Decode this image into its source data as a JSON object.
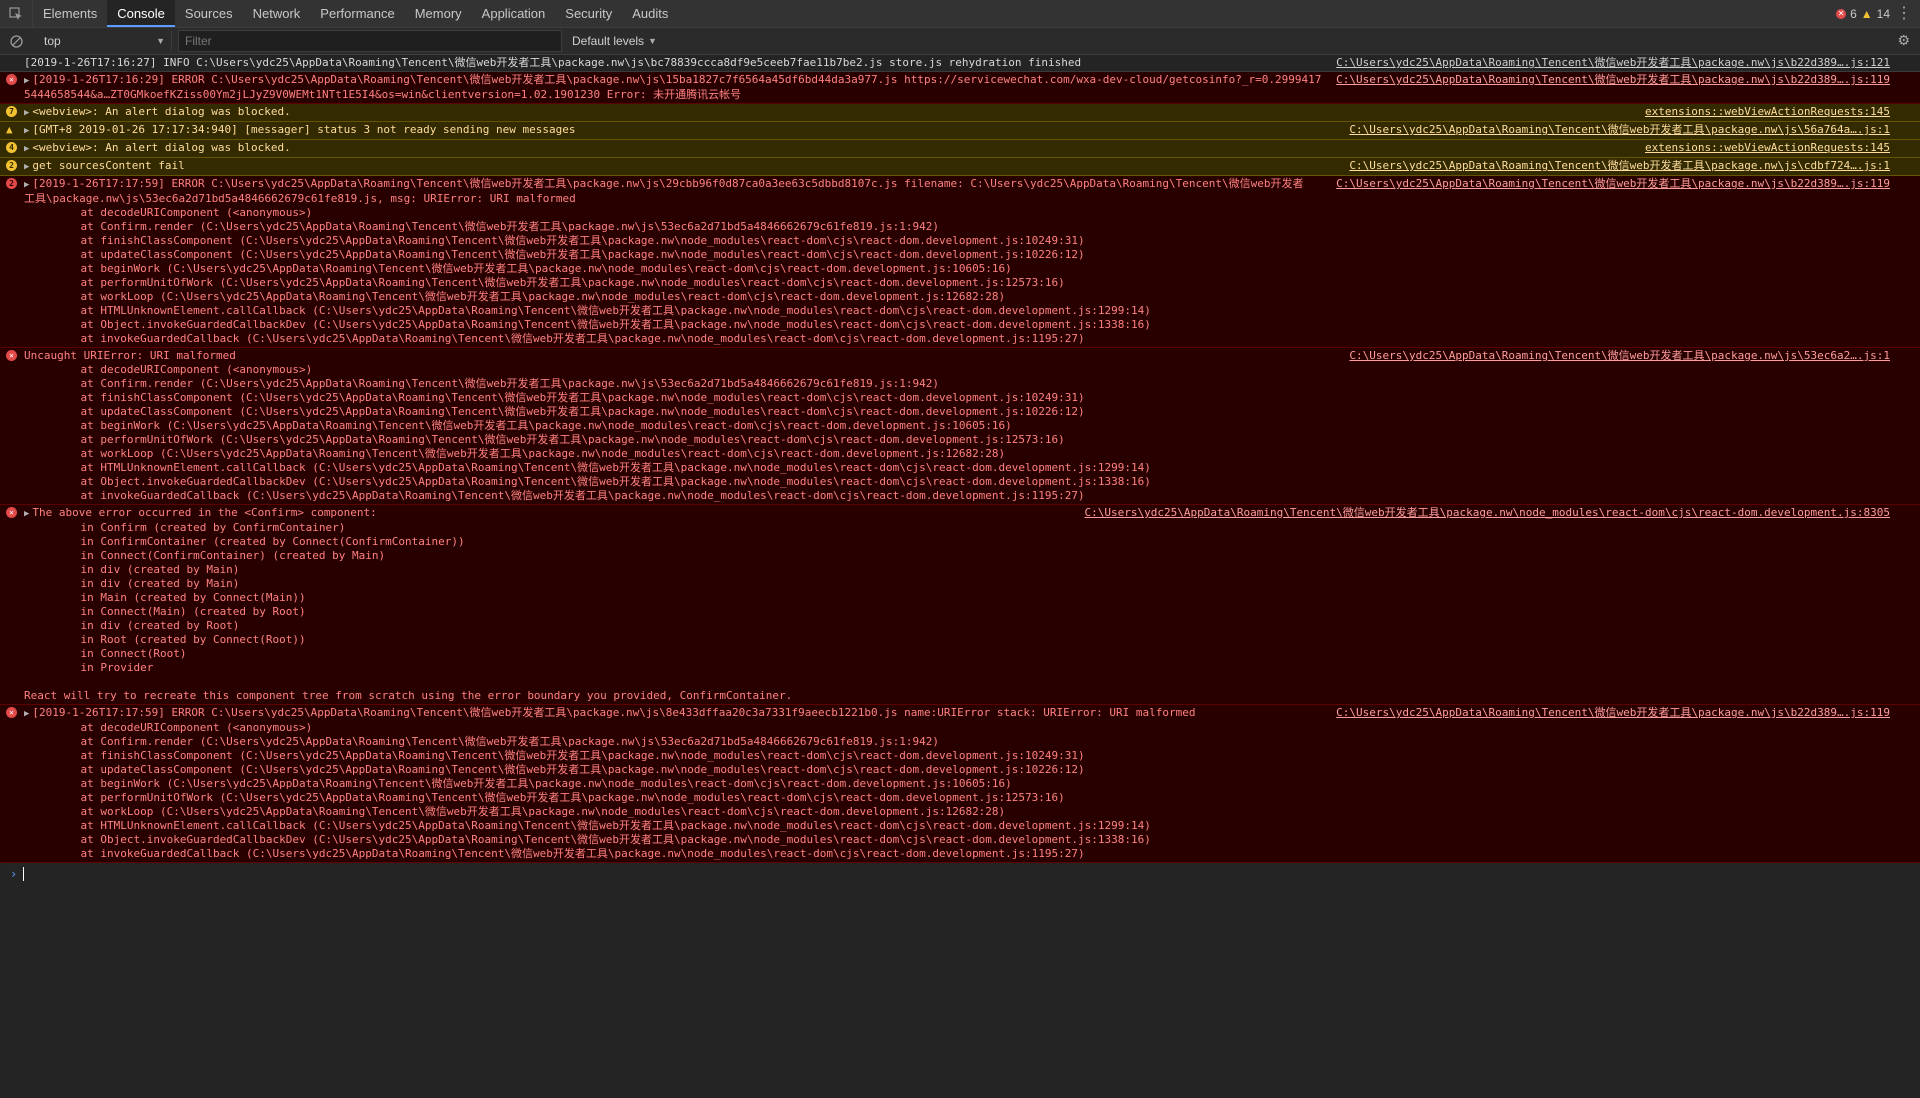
{
  "tabs": [
    "Elements",
    "Console",
    "Sources",
    "Network",
    "Performance",
    "Memory",
    "Application",
    "Security",
    "Audits"
  ],
  "counts": {
    "errors": "6",
    "warnings": "14"
  },
  "toolbar": {
    "context": "top",
    "filter_placeholder": "Filter",
    "levels": "Default levels"
  },
  "messages": [
    {
      "level": "info",
      "badge": "",
      "expand": false,
      "text": "[2019-1-26T17:16:27] INFO C:\\Users\\ydc25\\AppData\\Roaming\\Tencent\\微信web开发者工具\\package.nw\\js\\bc78839ccca8df9e5ceeb7fae11b7be2.js store.js rehydration finished",
      "source": "C:\\Users\\ydc25\\AppData\\Roaming\\Tencent\\微信web开发者工具\\package.nw\\js\\b22d389….js:121",
      "stack": []
    },
    {
      "level": "error",
      "badge": "",
      "expand": true,
      "text": "[2019-1-26T17:16:29] ERROR C:\\Users\\ydc25\\AppData\\Roaming\\Tencent\\微信web开发者工具\\package.nw\\js\\15ba1827c7f6564a45df6bd44da3a977.js https://servicewechat.com/wxa-dev-cloud/getcosinfo?_r=0.2999417",
      "source": "C:\\Users\\ydc25\\AppData\\Roaming\\Tencent\\微信web开发者工具\\package.nw\\js\\b22d389….js:119",
      "stack": [
        "5444658544&a…ZT0GMkoefKZiss00Ym2jLJyZ9V0WEMt1NTt1E5I4&os=win&clientversion=1.02.1901230 Error: 未开通腾讯云帐号"
      ]
    },
    {
      "level": "warning",
      "badge": "7",
      "expand": true,
      "text": "<webview>: An alert dialog was blocked.",
      "source": "extensions::webViewActionRequests:145",
      "stack": []
    },
    {
      "level": "warning",
      "badge": "",
      "expand": true,
      "text": "[GMT+8 2019-01-26 17:17:34:940] [messager] status 3 not ready sending new messages",
      "source": "C:\\Users\\ydc25\\AppData\\Roaming\\Tencent\\微信web开发者工具\\package.nw\\js\\56a764a….js:1",
      "stack": []
    },
    {
      "level": "warning",
      "badge": "4",
      "expand": true,
      "text": "<webview>: An alert dialog was blocked.",
      "source": "extensions::webViewActionRequests:145",
      "stack": []
    },
    {
      "level": "warning",
      "badge": "2",
      "expand": true,
      "text": "get sourcesContent fail",
      "source": "C:\\Users\\ydc25\\AppData\\Roaming\\Tencent\\微信web开发者工具\\package.nw\\js\\cdbf724….js:1",
      "stack": []
    },
    {
      "level": "error",
      "badge": "2",
      "expand": true,
      "text": "[2019-1-26T17:17:59] ERROR C:\\Users\\ydc25\\AppData\\Roaming\\Tencent\\微信web开发者工具\\package.nw\\js\\29cbb96f0d87ca0a3ee63c5dbbd8107c.js filename: C:\\Users\\ydc25\\AppData\\Roaming\\Tencent\\微信web开发者",
      "source": "C:\\Users\\ydc25\\AppData\\Roaming\\Tencent\\微信web开发者工具\\package.nw\\js\\b22d389….js:119",
      "stack": [
        "工具\\package.nw\\js\\53ec6a2d71bd5a4846662679c61fe819.js, msg: URIError: URI malformed",
        "    at decodeURIComponent (<anonymous>)",
        "    at Confirm.render (C:\\Users\\ydc25\\AppData\\Roaming\\Tencent\\微信web开发者工具\\package.nw\\js\\53ec6a2d71bd5a4846662679c61fe819.js:1:942)",
        "    at finishClassComponent (C:\\Users\\ydc25\\AppData\\Roaming\\Tencent\\微信web开发者工具\\package.nw\\node_modules\\react-dom\\cjs\\react-dom.development.js:10249:31)",
        "    at updateClassComponent (C:\\Users\\ydc25\\AppData\\Roaming\\Tencent\\微信web开发者工具\\package.nw\\node_modules\\react-dom\\cjs\\react-dom.development.js:10226:12)",
        "    at beginWork (C:\\Users\\ydc25\\AppData\\Roaming\\Tencent\\微信web开发者工具\\package.nw\\node_modules\\react-dom\\cjs\\react-dom.development.js:10605:16)",
        "    at performUnitOfWork (C:\\Users\\ydc25\\AppData\\Roaming\\Tencent\\微信web开发者工具\\package.nw\\node_modules\\react-dom\\cjs\\react-dom.development.js:12573:16)",
        "    at workLoop (C:\\Users\\ydc25\\AppData\\Roaming\\Tencent\\微信web开发者工具\\package.nw\\node_modules\\react-dom\\cjs\\react-dom.development.js:12682:28)",
        "    at HTMLUnknownElement.callCallback (C:\\Users\\ydc25\\AppData\\Roaming\\Tencent\\微信web开发者工具\\package.nw\\node_modules\\react-dom\\cjs\\react-dom.development.js:1299:14)",
        "    at Object.invokeGuardedCallbackDev (C:\\Users\\ydc25\\AppData\\Roaming\\Tencent\\微信web开发者工具\\package.nw\\node_modules\\react-dom\\cjs\\react-dom.development.js:1338:16)",
        "    at invokeGuardedCallback (C:\\Users\\ydc25\\AppData\\Roaming\\Tencent\\微信web开发者工具\\package.nw\\node_modules\\react-dom\\cjs\\react-dom.development.js:1195:27)"
      ]
    },
    {
      "level": "error",
      "badge": "",
      "expand": false,
      "text": "Uncaught URIError: URI malformed",
      "source": "C:\\Users\\ydc25\\AppData\\Roaming\\Tencent\\微信web开发者工具\\package.nw\\js\\53ec6a2….js:1",
      "stack": [
        "    at decodeURIComponent (<anonymous>)",
        "    at Confirm.render (C:\\Users\\ydc25\\AppData\\Roaming\\Tencent\\微信web开发者工具\\package.nw\\js\\53ec6a2d71bd5a4846662679c61fe819.js:1:942)",
        "    at finishClassComponent (C:\\Users\\ydc25\\AppData\\Roaming\\Tencent\\微信web开发者工具\\package.nw\\node_modules\\react-dom\\cjs\\react-dom.development.js:10249:31)",
        "    at updateClassComponent (C:\\Users\\ydc25\\AppData\\Roaming\\Tencent\\微信web开发者工具\\package.nw\\node_modules\\react-dom\\cjs\\react-dom.development.js:10226:12)",
        "    at beginWork (C:\\Users\\ydc25\\AppData\\Roaming\\Tencent\\微信web开发者工具\\package.nw\\node_modules\\react-dom\\cjs\\react-dom.development.js:10605:16)",
        "    at performUnitOfWork (C:\\Users\\ydc25\\AppData\\Roaming\\Tencent\\微信web开发者工具\\package.nw\\node_modules\\react-dom\\cjs\\react-dom.development.js:12573:16)",
        "    at workLoop (C:\\Users\\ydc25\\AppData\\Roaming\\Tencent\\微信web开发者工具\\package.nw\\node_modules\\react-dom\\cjs\\react-dom.development.js:12682:28)",
        "    at HTMLUnknownElement.callCallback (C:\\Users\\ydc25\\AppData\\Roaming\\Tencent\\微信web开发者工具\\package.nw\\node_modules\\react-dom\\cjs\\react-dom.development.js:1299:14)",
        "    at Object.invokeGuardedCallbackDev (C:\\Users\\ydc25\\AppData\\Roaming\\Tencent\\微信web开发者工具\\package.nw\\node_modules\\react-dom\\cjs\\react-dom.development.js:1338:16)",
        "    at invokeGuardedCallback (C:\\Users\\ydc25\\AppData\\Roaming\\Tencent\\微信web开发者工具\\package.nw\\node_modules\\react-dom\\cjs\\react-dom.development.js:1195:27)"
      ]
    },
    {
      "level": "error",
      "badge": "",
      "expand": true,
      "text": "The above error occurred in the <Confirm> component:",
      "source": "C:\\Users\\ydc25\\AppData\\Roaming\\Tencent\\微信web开发者工具\\package.nw\\node_modules\\react-dom\\cjs\\react-dom.development.js:8305",
      "stack": [
        "    in Confirm (created by ConfirmContainer)",
        "    in ConfirmContainer (created by Connect(ConfirmContainer))",
        "    in Connect(ConfirmContainer) (created by Main)",
        "    in div (created by Main)",
        "    in div (created by Main)",
        "    in Main (created by Connect(Main))",
        "    in Connect(Main) (created by Root)",
        "    in div (created by Root)",
        "    in Root (created by Connect(Root))",
        "    in Connect(Root)",
        "    in Provider",
        " ",
        "React will try to recreate this component tree from scratch using the error boundary you provided, ConfirmContainer."
      ]
    },
    {
      "level": "error",
      "badge": "",
      "expand": true,
      "text": "[2019-1-26T17:17:59] ERROR C:\\Users\\ydc25\\AppData\\Roaming\\Tencent\\微信web开发者工具\\package.nw\\js\\8e433dffaa20c3a7331f9aeecb1221b0.js name:URIError stack: URIError: URI malformed",
      "source": "C:\\Users\\ydc25\\AppData\\Roaming\\Tencent\\微信web开发者工具\\package.nw\\js\\b22d389….js:119",
      "stack": [
        "    at decodeURIComponent (<anonymous>)",
        "    at Confirm.render (C:\\Users\\ydc25\\AppData\\Roaming\\Tencent\\微信web开发者工具\\package.nw\\js\\53ec6a2d71bd5a4846662679c61fe819.js:1:942)",
        "    at finishClassComponent (C:\\Users\\ydc25\\AppData\\Roaming\\Tencent\\微信web开发者工具\\package.nw\\node_modules\\react-dom\\cjs\\react-dom.development.js:10249:31)",
        "    at updateClassComponent (C:\\Users\\ydc25\\AppData\\Roaming\\Tencent\\微信web开发者工具\\package.nw\\node_modules\\react-dom\\cjs\\react-dom.development.js:10226:12)",
        "    at beginWork (C:\\Users\\ydc25\\AppData\\Roaming\\Tencent\\微信web开发者工具\\package.nw\\node_modules\\react-dom\\cjs\\react-dom.development.js:10605:16)",
        "    at performUnitOfWork (C:\\Users\\ydc25\\AppData\\Roaming\\Tencent\\微信web开发者工具\\package.nw\\node_modules\\react-dom\\cjs\\react-dom.development.js:12573:16)",
        "    at workLoop (C:\\Users\\ydc25\\AppData\\Roaming\\Tencent\\微信web开发者工具\\package.nw\\node_modules\\react-dom\\cjs\\react-dom.development.js:12682:28)",
        "    at HTMLUnknownElement.callCallback (C:\\Users\\ydc25\\AppData\\Roaming\\Tencent\\微信web开发者工具\\package.nw\\node_modules\\react-dom\\cjs\\react-dom.development.js:1299:14)",
        "    at Object.invokeGuardedCallbackDev (C:\\Users\\ydc25\\AppData\\Roaming\\Tencent\\微信web开发者工具\\package.nw\\node_modules\\react-dom\\cjs\\react-dom.development.js:1338:16)",
        "    at invokeGuardedCallback (C:\\Users\\ydc25\\AppData\\Roaming\\Tencent\\微信web开发者工具\\package.nw\\node_modules\\react-dom\\cjs\\react-dom.development.js:1195:27)"
      ]
    }
  ]
}
